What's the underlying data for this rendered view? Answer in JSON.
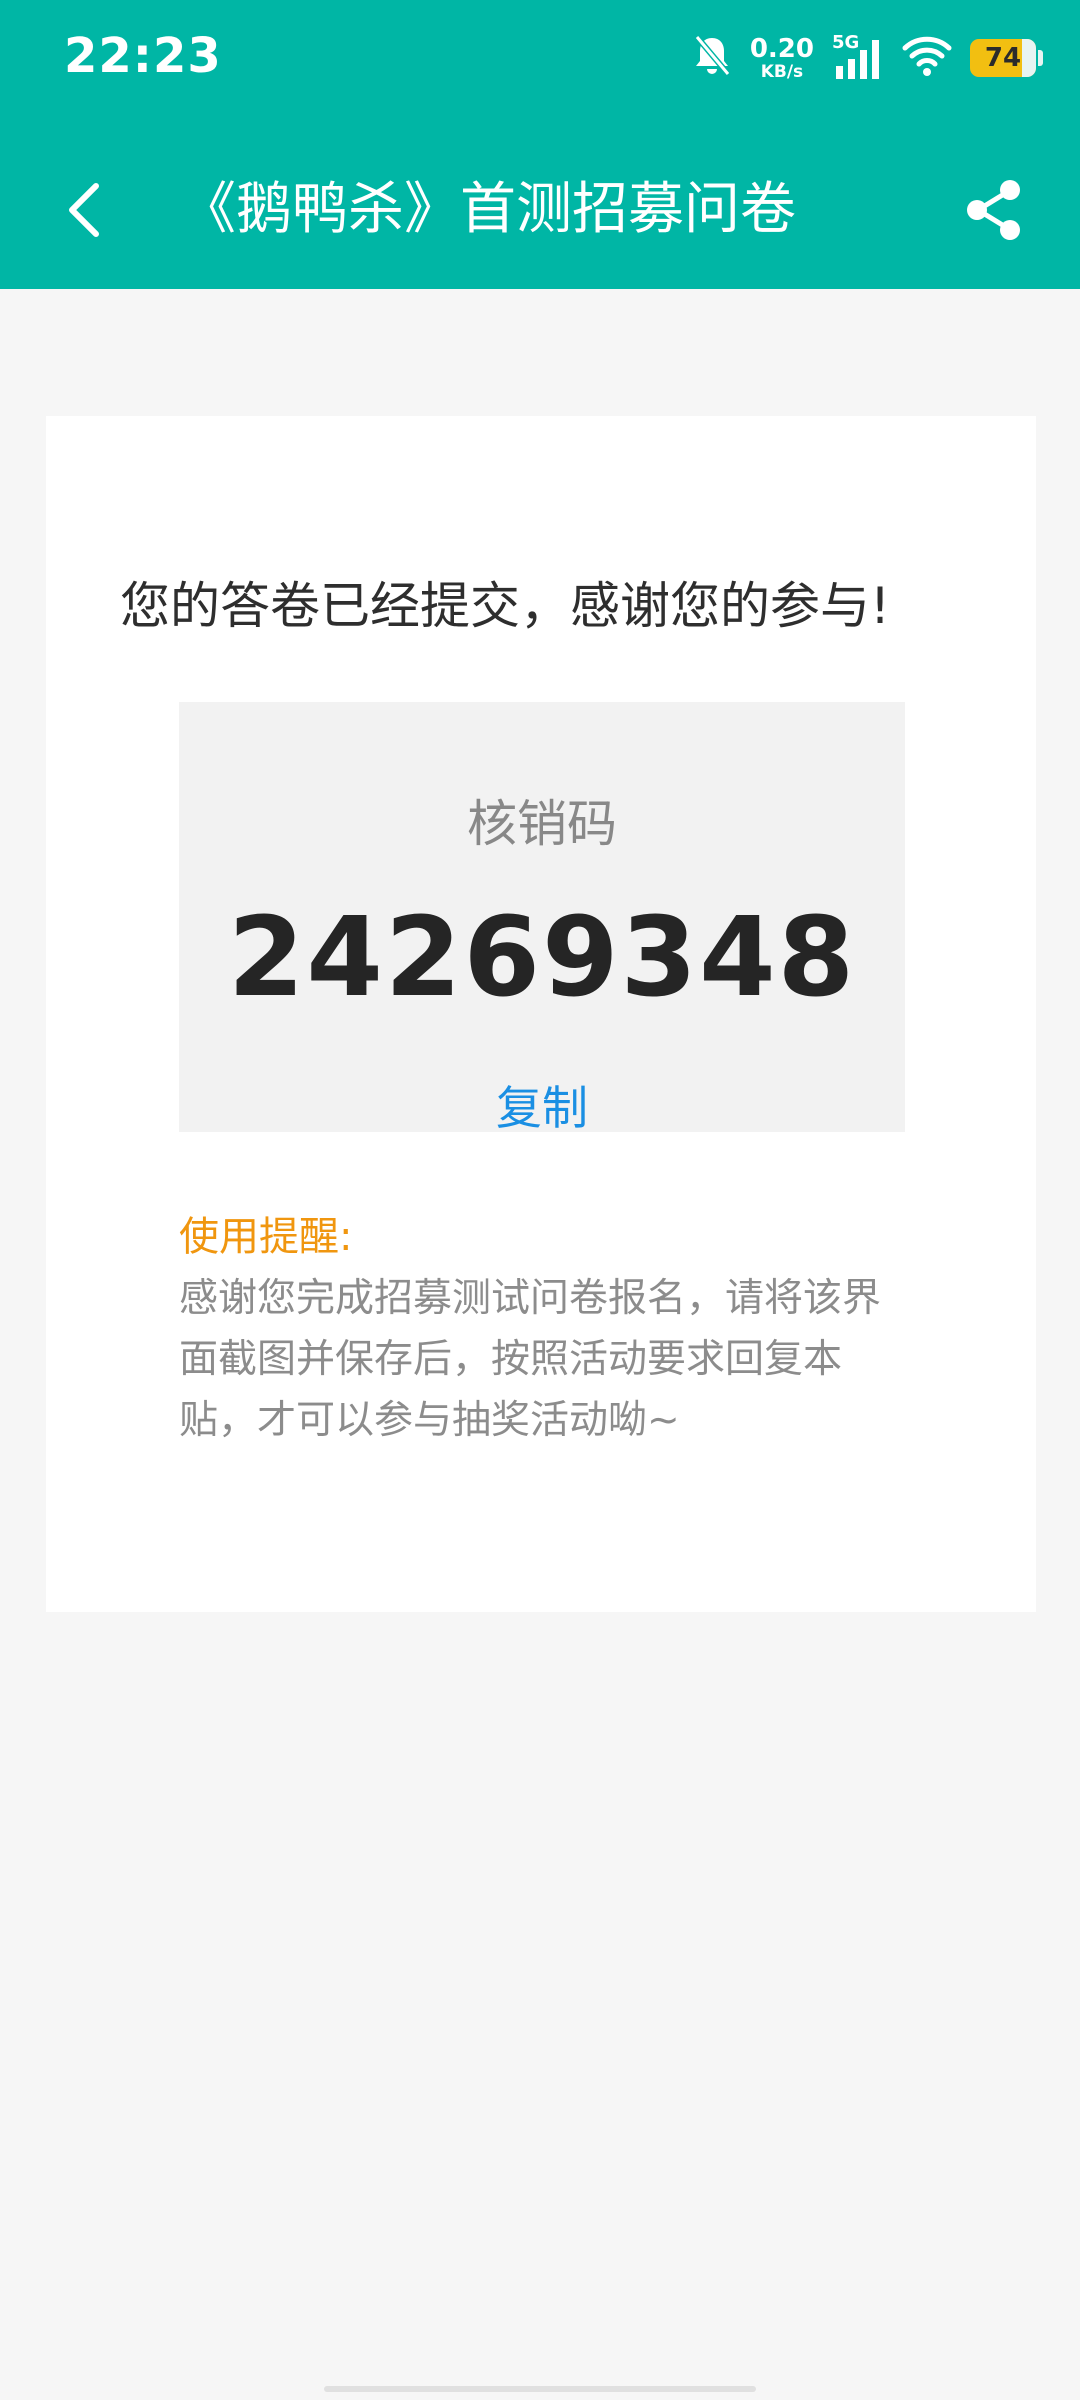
{
  "status_bar": {
    "time": "22:23",
    "net_speed_value": "0.20",
    "net_speed_unit": "KB/s",
    "network_type": "5G",
    "battery_level": "74"
  },
  "nav": {
    "title": "《鹅鸭杀》首测招募问卷"
  },
  "card": {
    "thanks_text": "您的答卷已经提交，感谢您的参与!",
    "code_label": "核销码",
    "code_value": "24269348",
    "copy_label": "复制",
    "tip_title": "使用提醒:",
    "tip_body": "感谢您完成招募测试问卷报名，请将该界面截图并保存后，按照活动要求回复本贴，才可以参与抽奖活动呦~"
  },
  "colors": {
    "header_bg": "#00b6a5",
    "page_bg": "#f6f6f6",
    "copy_link": "#1a8fe3",
    "tip_title": "#f0960f",
    "battery": "#f2bf11"
  },
  "icons": [
    "bell-off-icon",
    "signal-icon",
    "wifi-icon",
    "battery-icon",
    "back-arrow-icon",
    "share-icon"
  ]
}
